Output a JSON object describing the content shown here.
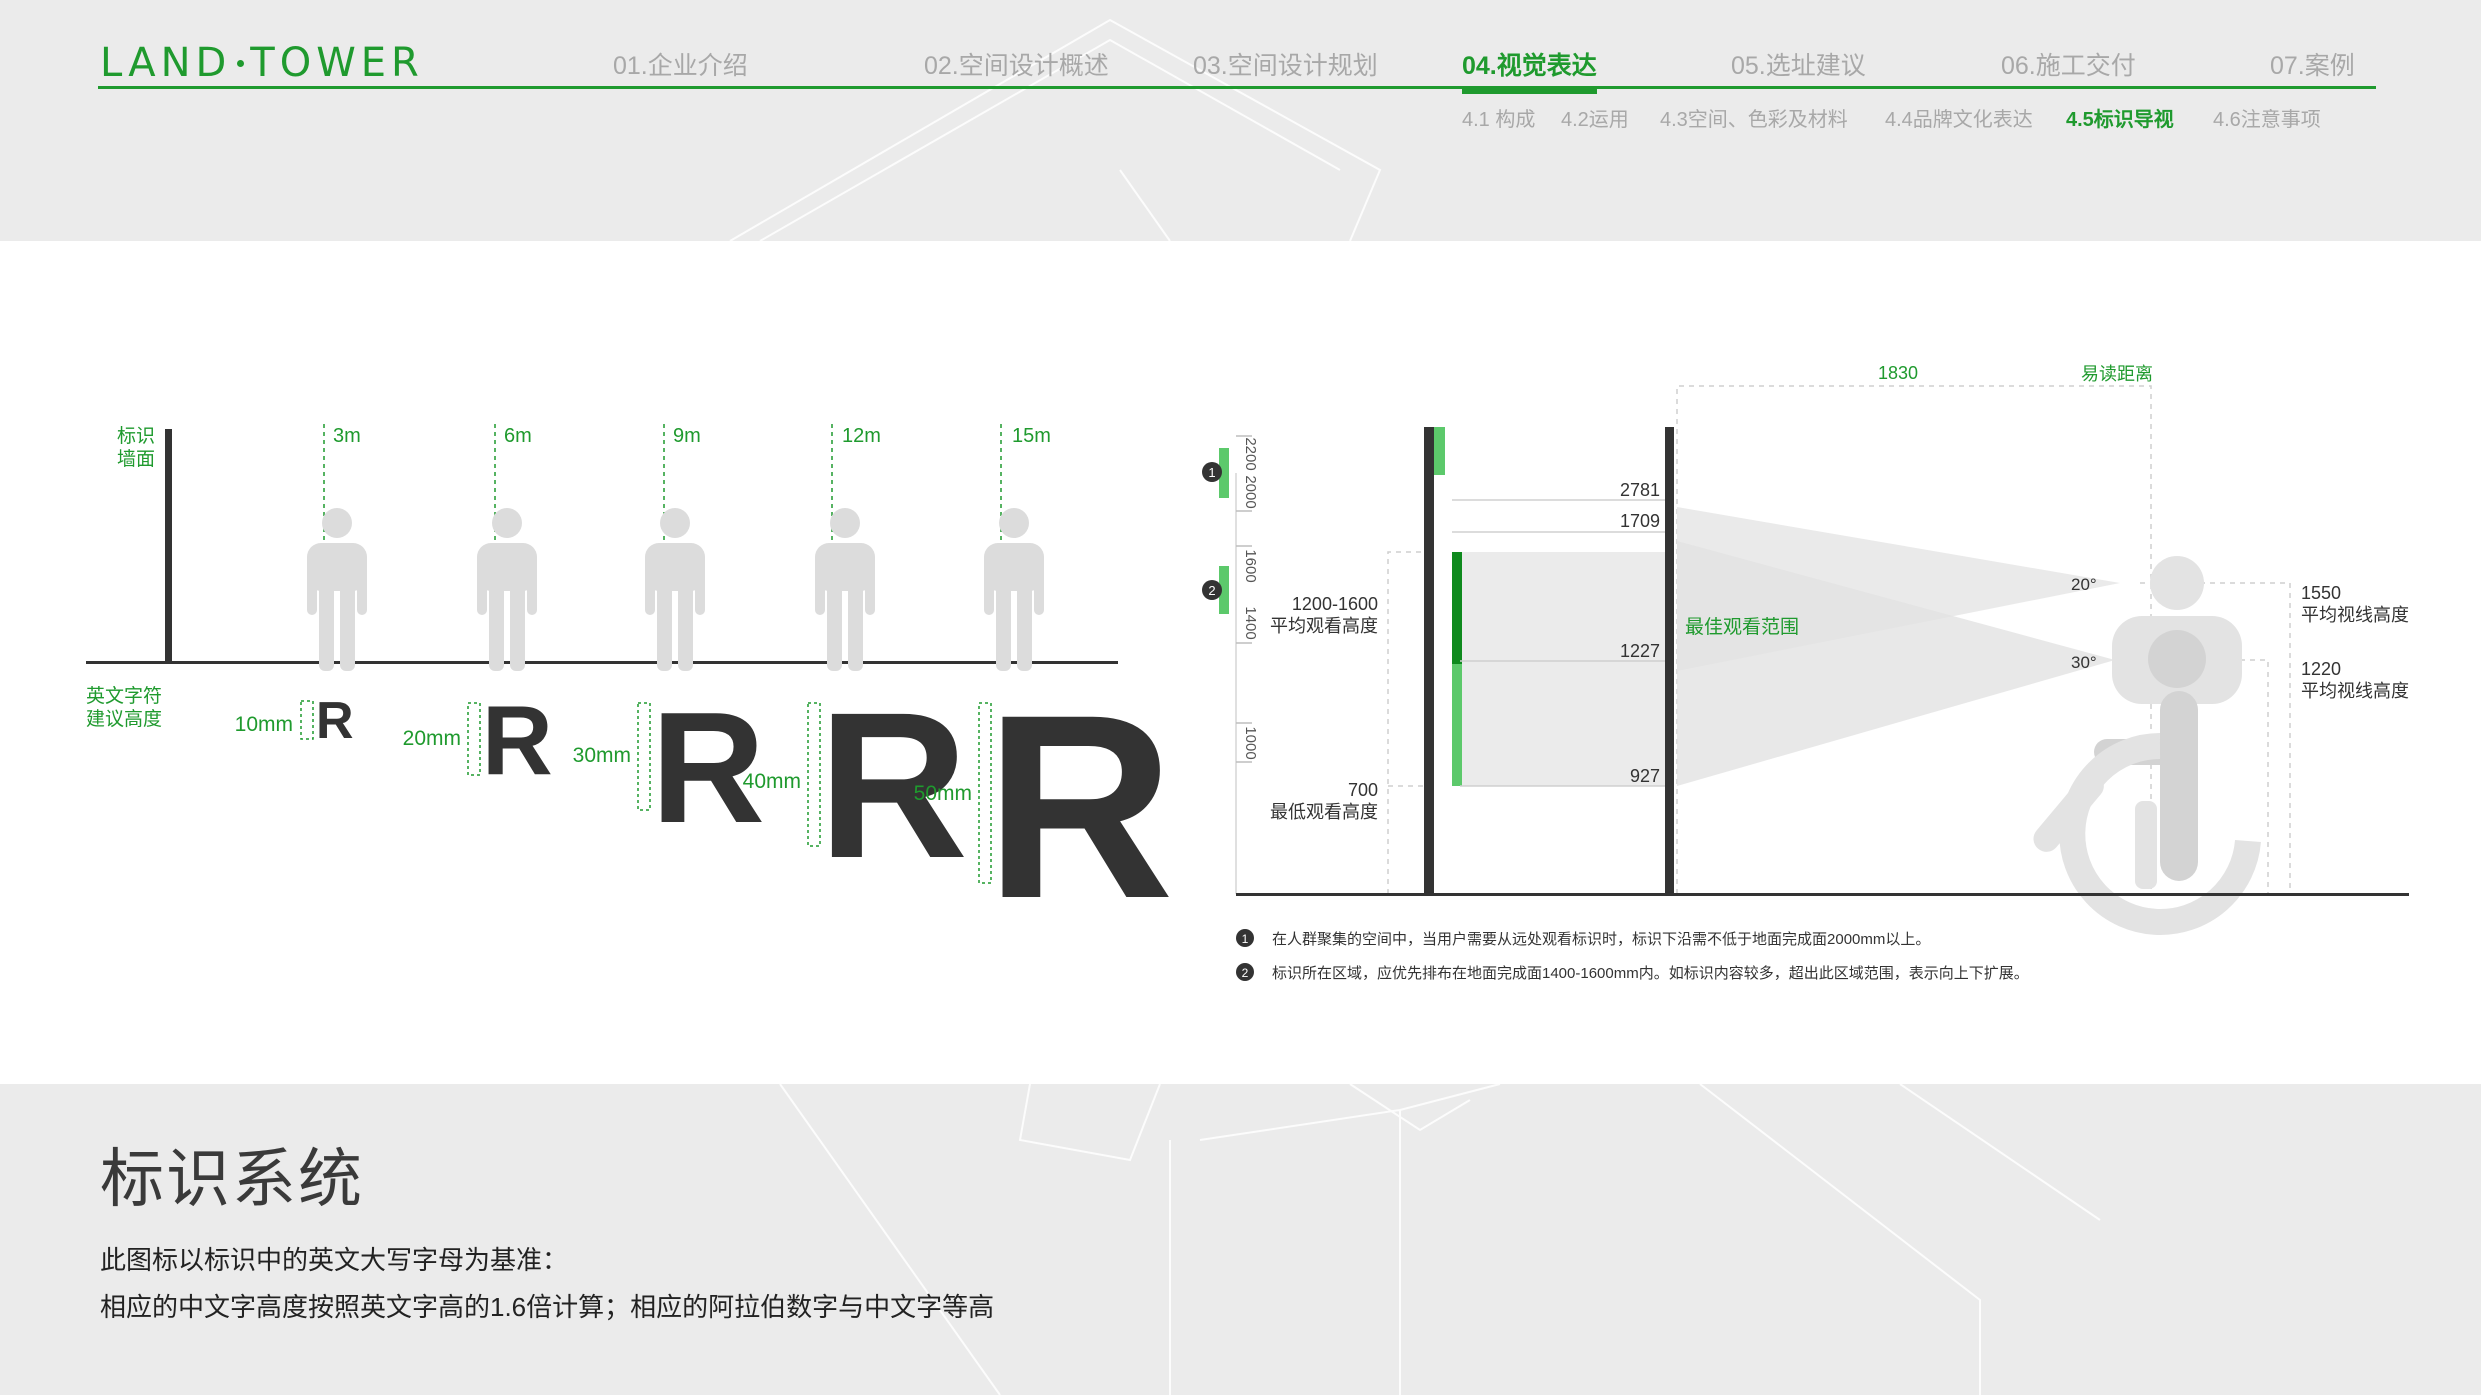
{
  "header": {
    "logo_left": "LAND",
    "logo_right": "TOWER",
    "nav": [
      {
        "label": "01.企业介绍",
        "active": false
      },
      {
        "label": "02.空间设计概述",
        "active": false
      },
      {
        "label": "03.空间设计规划",
        "active": false
      },
      {
        "label": "04.视觉表达",
        "active": true
      },
      {
        "label": "05.选址建议",
        "active": false
      },
      {
        "label": "06.施工交付",
        "active": false
      },
      {
        "label": "07.案例",
        "active": false
      }
    ],
    "subnav": [
      {
        "label": "4.1 构成",
        "active": false
      },
      {
        "label": "4.2运用",
        "active": false
      },
      {
        "label": "4.3空间、色彩及材料",
        "active": false
      },
      {
        "label": "4.4品牌文化表达",
        "active": false
      },
      {
        "label": "4.5标识导视",
        "active": true
      },
      {
        "label": "4.6注意事项",
        "active": false
      }
    ]
  },
  "left_diagram": {
    "wall_label_1": "标识",
    "wall_label_2": "墙面",
    "char_label_1": "英文字符",
    "char_label_2": "建议高度",
    "distances": [
      "3m",
      "6m",
      "9m",
      "12m",
      "15m"
    ],
    "heights": [
      "10mm",
      "20mm",
      "30mm",
      "40mm",
      "50mm"
    ],
    "letter": "R"
  },
  "right_diagram": {
    "dim_top": "1830",
    "easy_read": "易读距离",
    "range_label": "最佳观看范围",
    "markers": [
      "1",
      "2"
    ],
    "ruler": [
      "2200",
      "2000",
      "1600",
      "1400",
      "1000"
    ],
    "level_values": [
      "2781",
      "1709",
      "1227",
      "927"
    ],
    "left_labels": {
      "avg_val": "1200-1600",
      "avg_text": "平均观看高度",
      "min_val": "700",
      "min_text": "最低观看高度"
    },
    "angles": [
      "20°",
      "30°"
    ],
    "right_labels": {
      "standing_val": "1550",
      "standing_text": "平均视线高度",
      "seated_val": "1220",
      "seated_text": "平均视线高度"
    },
    "notes": [
      "在人群聚集的空间中，当用户需要从远处观看标识时，标识下沿需不低于地面完成面2000mm以上。",
      "标识所在区域，应优先排布在地面完成面1400-1600mm内。如标识内容较多，超出此区域范围，表示向上下扩展。"
    ]
  },
  "footer": {
    "title": "标识系统",
    "line1": "此图标以标识中的英文大写字母为基准：",
    "line2": "相应的中文字高度按照英文字高的1.6倍计算；相应的阿拉伯数字与中文字等高"
  },
  "colors": {
    "brand_green": "#1f9a2e",
    "light_green": "#5cc96b",
    "dark": "#333333",
    "figure_gray": "#dcdcdc"
  }
}
